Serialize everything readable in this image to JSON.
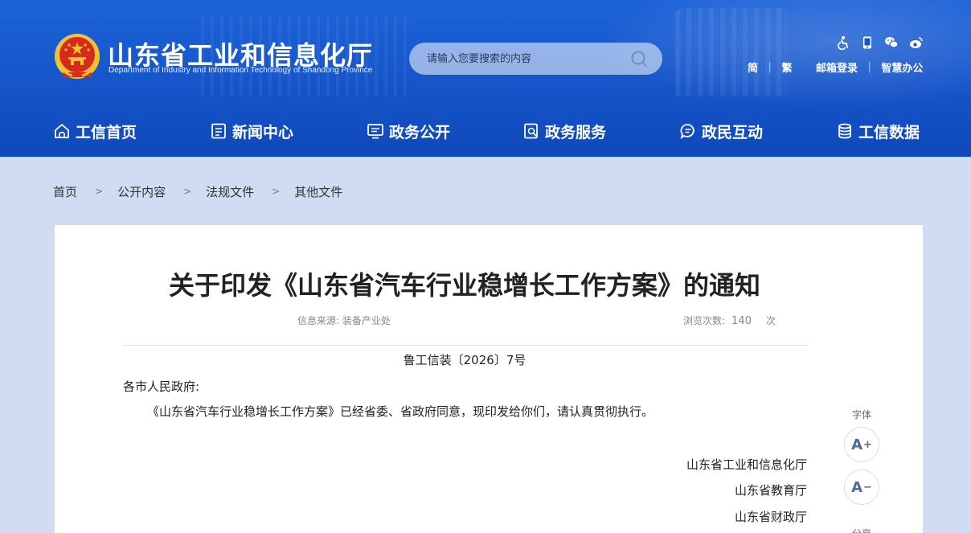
{
  "header": {
    "site_title": "山东省工业和信息化厅",
    "site_subtitle": "Department of Industry and Information Technology of Shandong Province",
    "search_placeholder": "请输入您要搜索的内容",
    "tools": [
      "accessibility-icon",
      "mobile-icon",
      "wechat-icon",
      "weibo-icon"
    ],
    "links": {
      "simplified": "简",
      "traditional": "繁",
      "mail_login": "邮箱登录",
      "smart_office": "智慧办公"
    }
  },
  "nav": [
    {
      "label": "工信首页",
      "icon": "home-icon"
    },
    {
      "label": "新闻中心",
      "icon": "news-icon"
    },
    {
      "label": "政务公开",
      "icon": "monitor-icon"
    },
    {
      "label": "政务服务",
      "icon": "service-icon"
    },
    {
      "label": "政民互动",
      "icon": "chat-icon"
    },
    {
      "label": "工信数据",
      "icon": "database-icon"
    }
  ],
  "breadcrumb": {
    "items": [
      "首页",
      "公开内容",
      "法规文件",
      "其他文件"
    ],
    "separator": ">"
  },
  "article": {
    "title": "关于印发《山东省汽车行业稳增长工作方案》的通知",
    "source": "信息来源: 装备产业处",
    "views_label": "浏览次数:",
    "views_count": "140",
    "views_unit": "次",
    "doc_number": "鲁工信装〔2026〕7号",
    "salutation": "各市人民政府:",
    "body": "《山东省汽车行业稳增长工作方案》已经省委、省政府同意，现印发给你们，请认真贯彻执行。",
    "signers": [
      "山东省工业和信息化厅",
      "山东省教育厅",
      "山东省财政厅"
    ]
  },
  "font_tools": {
    "label": "字体",
    "increase": "A",
    "increase_sign": "+",
    "decrease": "A",
    "decrease_sign": "−",
    "share_label": "分享"
  },
  "colors": {
    "header_blue": "#1554c9",
    "page_bg": "#cfdcf1",
    "emblem_red": "#d62a1e",
    "emblem_gold": "#f1c232"
  }
}
